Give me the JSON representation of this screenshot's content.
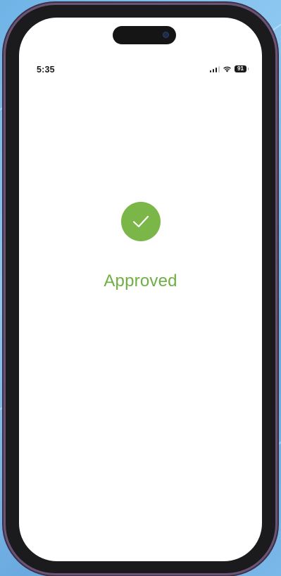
{
  "status_bar": {
    "time": "5:35",
    "battery_level": "91",
    "icons": [
      "signal-icon",
      "wifi-icon",
      "battery-icon"
    ]
  },
  "result": {
    "icon": "checkmark-icon",
    "label": "Approved"
  },
  "colors": {
    "success_green": "#7ab648",
    "success_text": "#6faf43",
    "frame": "#1b1b1d",
    "frame_accent": "#6a5476",
    "background": "#8cc7f0"
  }
}
